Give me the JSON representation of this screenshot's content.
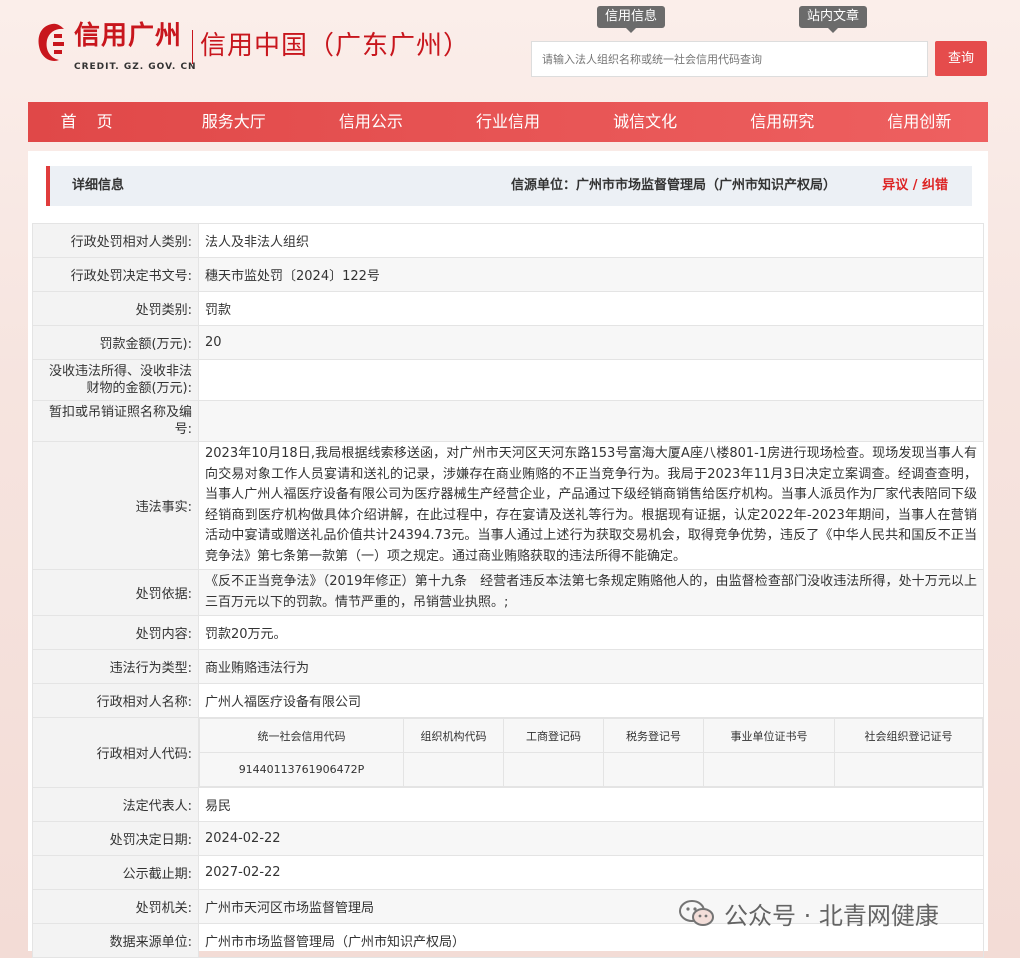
{
  "header": {
    "logo_text": "信用广州",
    "logo_sub": "CREDIT. GZ. GOV. CN",
    "site_title": "信用中国（广东广州）",
    "tabs": [
      "信用信息",
      "站内文章"
    ],
    "search_placeholder": "请输入法人组织名称或统一社会信用代码查询",
    "search_button": "查询"
  },
  "nav": [
    "首页",
    "服务大厅",
    "信用公示",
    "行业信用",
    "诚信文化",
    "信用研究",
    "信用创新"
  ],
  "panel": {
    "title": "详细信息",
    "source": "信源单位：广州市市场监督管理局（广州市知识产权局）",
    "objection": "异议 / 纠错"
  },
  "rows": {
    "r1": {
      "k": "行政处罚相对人类别:",
      "v": "法人及非法人组织"
    },
    "r2": {
      "k": "行政处罚决定书文号:",
      "v": "穗天市监处罚〔2024〕122号"
    },
    "r3": {
      "k": "处罚类别:",
      "v": "罚款"
    },
    "r4": {
      "k": "罚款金额(万元):",
      "v": "20"
    },
    "r5": {
      "k": "没收违法所得、没收非法财物的金额(万元):",
      "v": ""
    },
    "r6": {
      "k": "暂扣或吊销证照名称及编号:",
      "v": ""
    },
    "r7": {
      "k": "违法事实:",
      "v": "2023年10月18日,我局根据线索移送函，对广州市天河区天河东路153号富海大厦A座八楼801-1房进行现场检查。现场发现当事人有向交易对象工作人员宴请和送礼的记录，涉嫌存在商业贿赂的不正当竞争行为。我局于2023年11月3日决定立案调查。经调查查明，当事人广州人福医疗设备有限公司为医疗器械生产经营企业，产品通过下级经销商销售给医疗机构。当事人派员作为厂家代表陪同下级经销商到医疗机构做具体介绍讲解，在此过程中，存在宴请及送礼等行为。根据现有证据，认定2022年-2023年期间，当事人在营销活动中宴请或赠送礼品价值共计24394.73元。当事人通过上述行为获取交易机会，取得竞争优势，违反了《中华人民共和国反不正当竞争法》第七条第一款第（一）项之规定。通过商业贿赂获取的违法所得不能确定。"
    },
    "r8": {
      "k": "处罚依据:",
      "v": "《反不正当竞争法》（2019年修正）第十九条　经营者违反本法第七条规定贿赂他人的，由监督检查部门没收违法所得，处十万元以上三百万元以下的罚款。情节严重的，吊销营业执照。;"
    },
    "r9": {
      "k": "处罚内容:",
      "v": "罚款20万元。"
    },
    "r10": {
      "k": "违法行为类型:",
      "v": "商业贿赂违法行为"
    },
    "r11": {
      "k": "行政相对人名称:",
      "v": "广州人福医疗设备有限公司"
    },
    "r12": {
      "k": "行政相对人代码:"
    },
    "r13": {
      "k": "法定代表人:",
      "v": "易民"
    },
    "r14": {
      "k": "处罚决定日期:",
      "v": "2024-02-22"
    },
    "r15": {
      "k": "公示截止期:",
      "v": "2027-02-22"
    },
    "r16": {
      "k": "处罚机关:",
      "v": "广州市天河区市场监督管理局"
    },
    "r17": {
      "k": "数据来源单位:",
      "v": "广州市市场监督管理局（广州市知识产权局）"
    }
  },
  "codes": {
    "headers": [
      "统一社会信用代码",
      "组织机构代码",
      "工商登记码",
      "税务登记号",
      "事业单位证书号",
      "社会组织登记证号"
    ],
    "values": [
      "91440113761906472P",
      "",
      "",
      "",
      "",
      ""
    ]
  },
  "watermark": "公众号 · 北青网健康",
  "colors": {
    "brand_red": "#c8161d",
    "nav_red": "#e04848",
    "button_red": "#e54c4c"
  }
}
